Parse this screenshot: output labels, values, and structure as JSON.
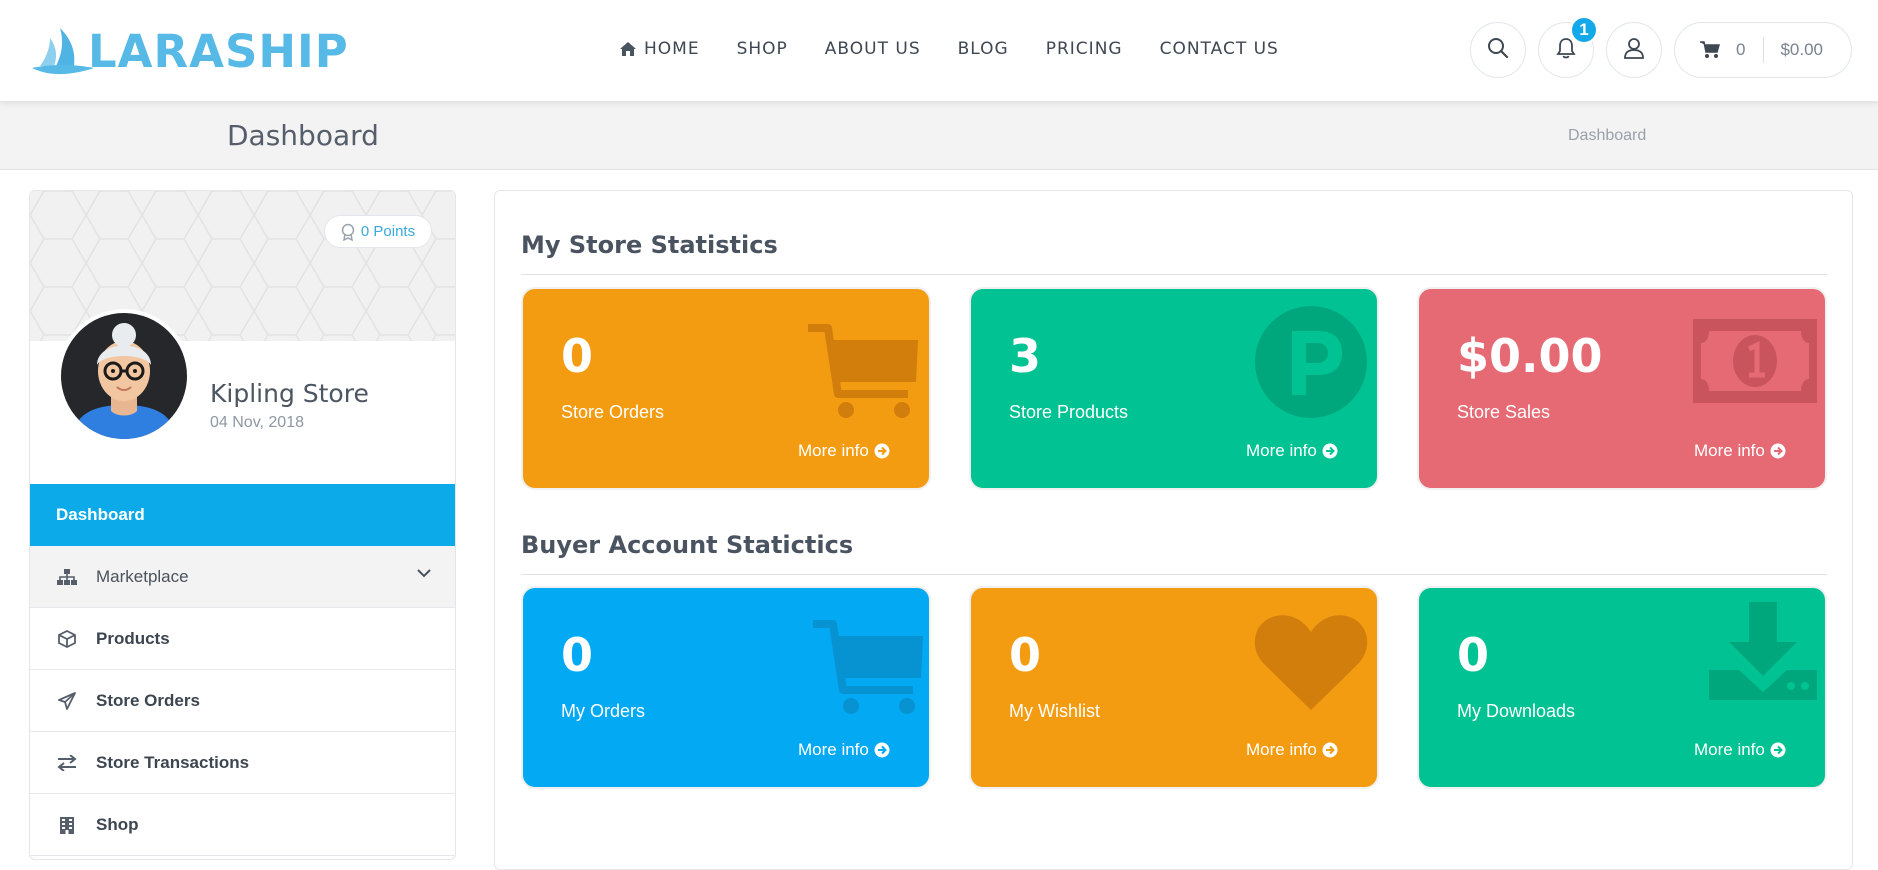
{
  "brand": {
    "name": "LARASHIP",
    "color": "#56b9e6"
  },
  "nav": {
    "items": [
      {
        "label": "HOME",
        "icon": "home-icon"
      },
      {
        "label": "SHOP"
      },
      {
        "label": "ABOUT US"
      },
      {
        "label": "BLOG"
      },
      {
        "label": "PRICING"
      },
      {
        "label": "CONTACT US"
      }
    ]
  },
  "header": {
    "notification_count": "1",
    "cart_count": "0",
    "cart_total": "$0.00"
  },
  "page": {
    "title": "Dashboard",
    "breadcrumb": "Dashboard"
  },
  "profile": {
    "points": "0 Points",
    "store_name": "Kipling Store",
    "date": "04 Nov, 2018"
  },
  "sidebar": {
    "items": [
      {
        "label": "Dashboard",
        "active": true
      },
      {
        "label": "Marketplace",
        "icon": "sitemap-icon",
        "expandable": true
      },
      {
        "label": "Products",
        "icon": "cube-icon"
      },
      {
        "label": "Store Orders",
        "icon": "paper-plane-icon"
      },
      {
        "label": "Store Transactions",
        "icon": "exchange-icon"
      },
      {
        "label": "Shop",
        "icon": "building-icon"
      }
    ]
  },
  "store_stats": {
    "title": "My Store Statistics",
    "cards": [
      {
        "value": "0",
        "label": "Store Orders",
        "more": "More info",
        "icon": "cart-icon",
        "color": "#f39c12"
      },
      {
        "value": "3",
        "label": "Store Products",
        "more": "More info",
        "icon": "product-p-icon",
        "color": "#00c292"
      },
      {
        "value": "$0.00",
        "label": "Store Sales",
        "more": "More info",
        "icon": "money-bill-icon",
        "color": "#e56a74"
      }
    ]
  },
  "buyer_stats": {
    "title": "Buyer Account Statictics",
    "cards": [
      {
        "value": "0",
        "label": "My Orders",
        "more": "More info",
        "icon": "cart-icon",
        "color": "#03a9f3"
      },
      {
        "value": "0",
        "label": "My Wishlist",
        "more": "More info",
        "icon": "heart-icon",
        "color": "#f39c12"
      },
      {
        "value": "0",
        "label": "My Downloads",
        "more": "More info",
        "icon": "download-icon",
        "color": "#00c292"
      }
    ]
  }
}
